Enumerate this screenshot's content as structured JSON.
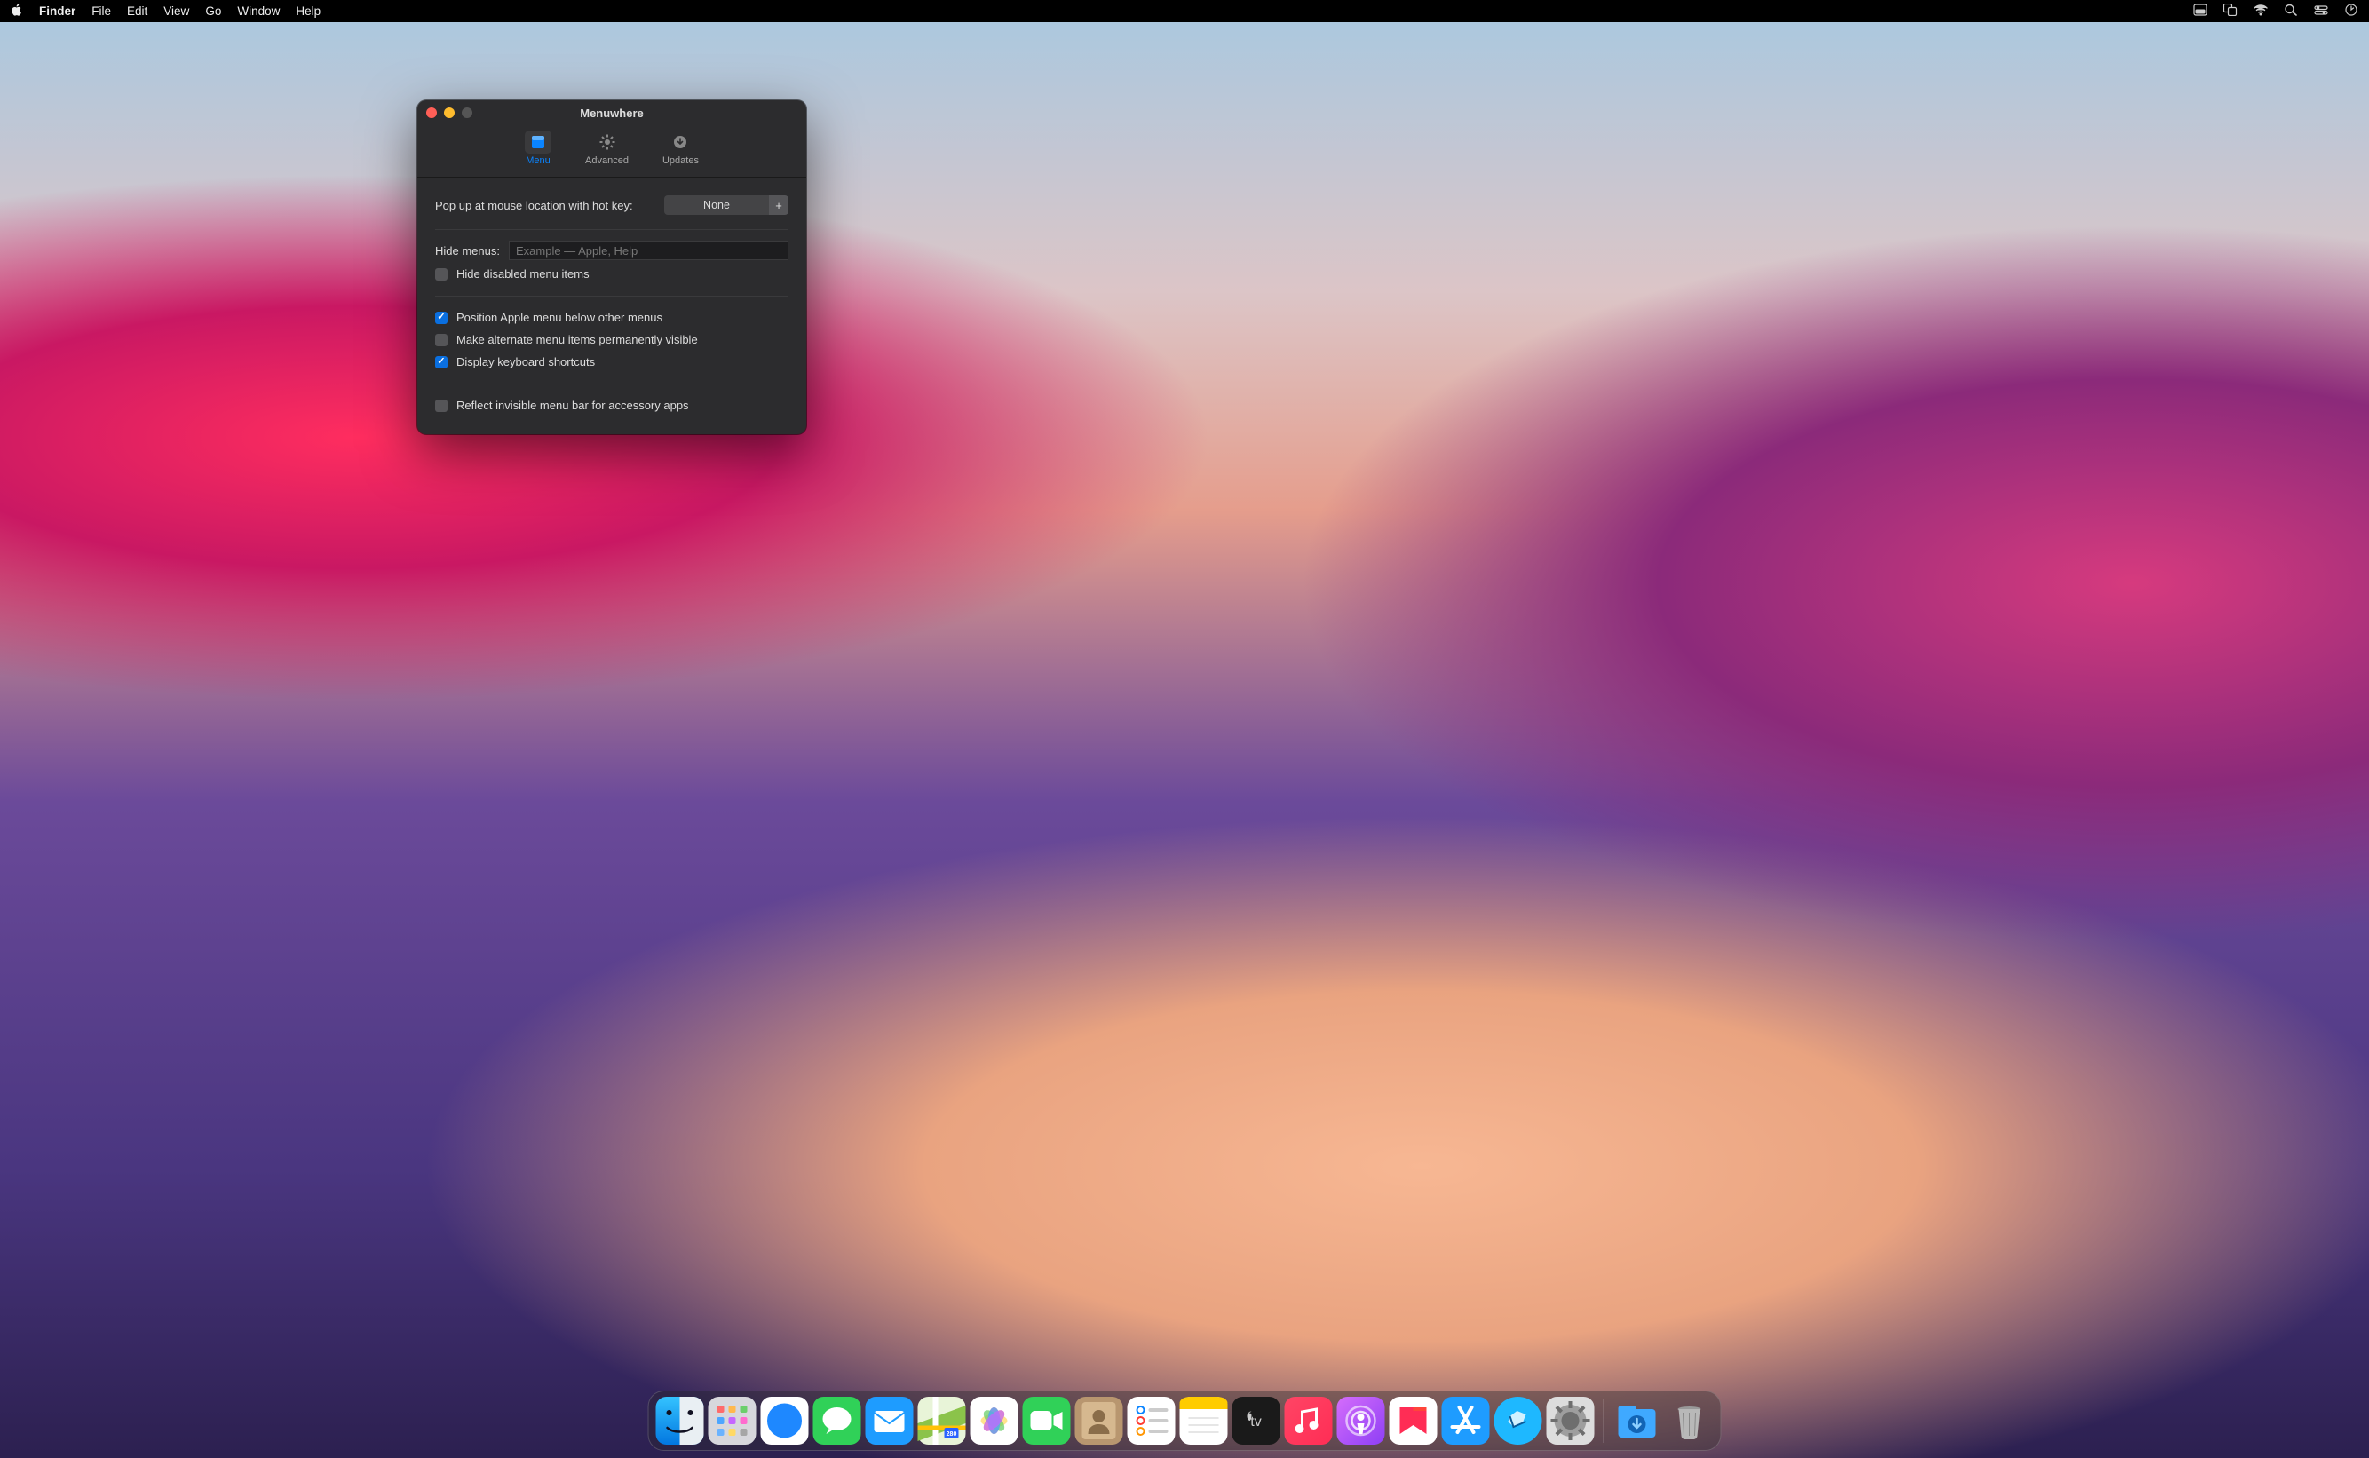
{
  "menubar": {
    "app": "Finder",
    "items": [
      "File",
      "Edit",
      "View",
      "Go",
      "Window",
      "Help"
    ],
    "right_icons": [
      "window-icon",
      "mission-control-icon",
      "wifi-icon",
      "search-icon",
      "control-center-icon",
      "clock-icon"
    ]
  },
  "window": {
    "title": "Menuwhere",
    "tabs": [
      {
        "id": "menu",
        "label": "Menu",
        "active": true
      },
      {
        "id": "advanced",
        "label": "Advanced",
        "active": false
      },
      {
        "id": "updates",
        "label": "Updates",
        "active": false
      }
    ],
    "hotkey_label": "Pop up at mouse location with hot key:",
    "hotkey_value": "None",
    "hotkey_plus": "+",
    "hide_label": "Hide menus:",
    "hide_placeholder": "Example — Apple, Help",
    "opts": {
      "hide_disabled": {
        "label": "Hide disabled menu items",
        "checked": false
      },
      "position_apple": {
        "label": "Position Apple menu below other menus",
        "checked": true
      },
      "alternates": {
        "label": "Make alternate menu items permanently visible",
        "checked": false
      },
      "shortcuts": {
        "label": "Display keyboard shortcuts",
        "checked": true
      },
      "reflect": {
        "label": "Reflect invisible menu bar for accessory apps",
        "checked": false
      }
    }
  },
  "dock": {
    "items": [
      "Finder",
      "Launchpad",
      "Safari",
      "Messages",
      "Mail",
      "Maps",
      "Photos",
      "FaceTime",
      "Contacts",
      "Reminders",
      "Notes",
      "TV",
      "Music",
      "Podcasts",
      "News",
      "App Store",
      "Freeform",
      "System Settings"
    ],
    "right_items": [
      "Downloads",
      "Trash"
    ]
  }
}
